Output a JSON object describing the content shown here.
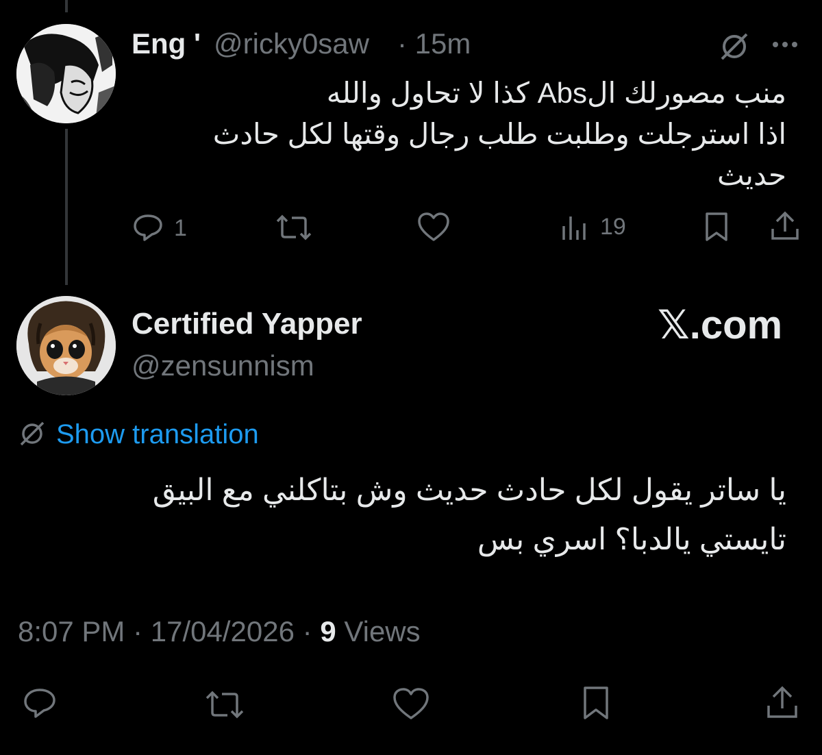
{
  "reply_to": {
    "display_name": "Eng '",
    "handle": "@ricky0saw",
    "time_ago": "15m",
    "text_lines": [
      "منب مصورلك الAbs كذا لا تحاول والله",
      "اذا استرجلت وطلبت طلب رجال وقتها لكل حادث",
      "حديث"
    ],
    "replies": "1",
    "views": "19",
    "icons": [
      "grok-icon",
      "more-icon",
      "reply-icon",
      "retweet-icon",
      "like-icon",
      "views-icon",
      "bookmark-icon",
      "share-icon"
    ]
  },
  "main": {
    "display_name": "Certified Yapper",
    "handle": "@zensunnism",
    "watermark": "𝕏.com",
    "translate_label": "Show translation",
    "text_lines": [
      "يا ساتر يقول لكل حادث حديث وش بتاكلني مع البيق",
      "تايستي يالدبا؟ اسري بس"
    ],
    "time": "8:07 PM",
    "date": "17/04/2026",
    "views_count": "9",
    "views_label": "Views",
    "separator": "·",
    "icons": [
      "reply-icon",
      "retweet-icon",
      "like-icon",
      "bookmark-icon",
      "share-icon"
    ]
  },
  "colors": {
    "background": "#000000",
    "text": "#e7e9ea",
    "muted": "#71767b",
    "link": "#1d9bf0"
  }
}
